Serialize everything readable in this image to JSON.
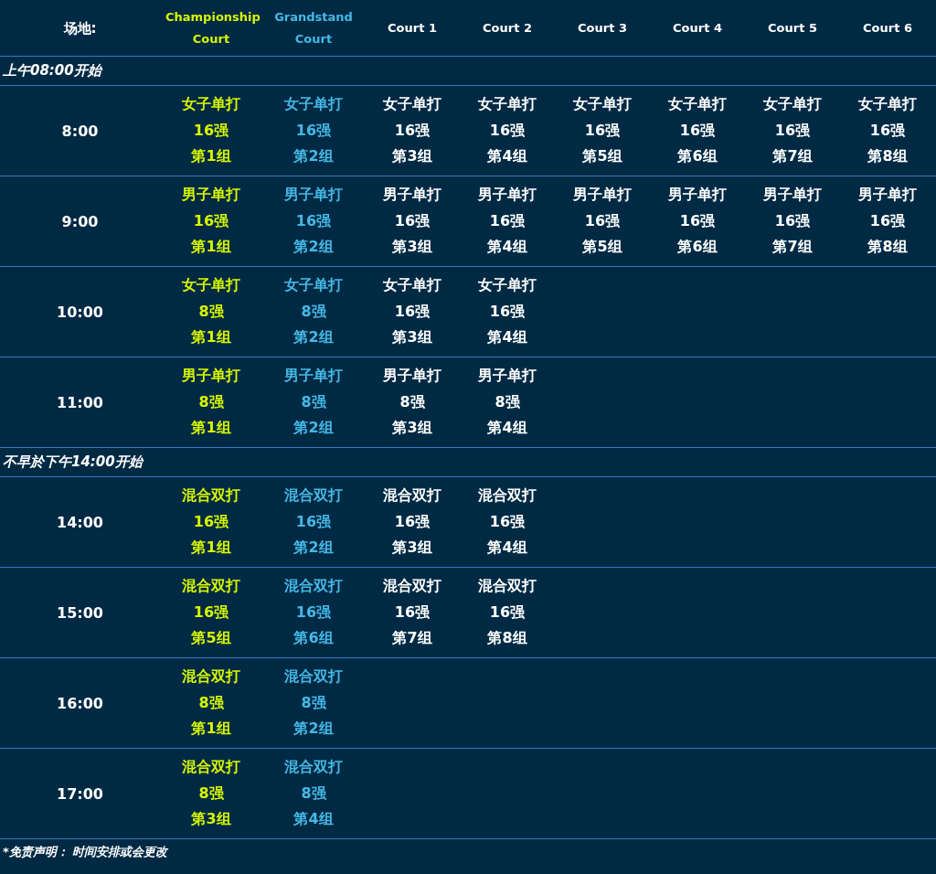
{
  "venue_label": "场地:",
  "courts": [
    {
      "label": "Championship Court",
      "color": "#d7f600"
    },
    {
      "label": "Grandstand Court",
      "color": "#45b8e6"
    },
    {
      "label": "Court 1",
      "color": "#ffffff"
    },
    {
      "label": "Court 2",
      "color": "#ffffff"
    },
    {
      "label": "Court 3",
      "color": "#ffffff"
    },
    {
      "label": "Court 4",
      "color": "#ffffff"
    },
    {
      "label": "Court 5",
      "color": "#ffffff"
    },
    {
      "label": "Court 6",
      "color": "#ffffff"
    }
  ],
  "sections": [
    {
      "heading": "上午08:00开始",
      "rows": [
        {
          "time": "8:00",
          "cells": [
            {
              "event": "女子单打",
              "round": "16强",
              "group": "第1组"
            },
            {
              "event": "女子单打",
              "round": "16强",
              "group": "第2组"
            },
            {
              "event": "女子单打",
              "round": "16强",
              "group": "第3组"
            },
            {
              "event": "女子单打",
              "round": "16强",
              "group": "第4组"
            },
            {
              "event": "女子单打",
              "round": "16强",
              "group": "第5组"
            },
            {
              "event": "女子单打",
              "round": "16强",
              "group": "第6组"
            },
            {
              "event": "女子单打",
              "round": "16强",
              "group": "第7组"
            },
            {
              "event": "女子单打",
              "round": "16强",
              "group": "第8组"
            }
          ]
        },
        {
          "time": "9:00",
          "cells": [
            {
              "event": "男子单打",
              "round": "16强",
              "group": "第1组"
            },
            {
              "event": "男子单打",
              "round": "16强",
              "group": "第2组"
            },
            {
              "event": "男子单打",
              "round": "16强",
              "group": "第3组"
            },
            {
              "event": "男子单打",
              "round": "16强",
              "group": "第4组"
            },
            {
              "event": "男子单打",
              "round": "16强",
              "group": "第5组"
            },
            {
              "event": "男子单打",
              "round": "16强",
              "group": "第6组"
            },
            {
              "event": "男子单打",
              "round": "16强",
              "group": "第7组"
            },
            {
              "event": "男子单打",
              "round": "16强",
              "group": "第8组"
            }
          ]
        },
        {
          "time": "10:00",
          "cells": [
            {
              "event": "女子单打",
              "round": "8强",
              "group": "第1组"
            },
            {
              "event": "女子单打",
              "round": "8强",
              "group": "第2组"
            },
            {
              "event": "女子单打",
              "round": "16强",
              "group": "第3组"
            },
            {
              "event": "女子单打",
              "round": "16强",
              "group": "第4组"
            }
          ]
        },
        {
          "time": "11:00",
          "cells": [
            {
              "event": "男子单打",
              "round": "8强",
              "group": "第1组"
            },
            {
              "event": "男子单打",
              "round": "8强",
              "group": "第2组"
            },
            {
              "event": "男子单打",
              "round": "8强",
              "group": "第3组"
            },
            {
              "event": "男子单打",
              "round": "8强",
              "group": "第4组"
            }
          ]
        }
      ]
    },
    {
      "heading": "不早於下午14:00开始",
      "rows": [
        {
          "time": "14:00",
          "cells": [
            {
              "event": "混合双打",
              "round": "16强",
              "group": "第1组"
            },
            {
              "event": "混合双打",
              "round": "16强",
              "group": "第2组"
            },
            {
              "event": "混合双打",
              "round": "16强",
              "group": "第3组"
            },
            {
              "event": "混合双打",
              "round": "16强",
              "group": "第4组"
            }
          ]
        },
        {
          "time": "15:00",
          "cells": [
            {
              "event": "混合双打",
              "round": "16强",
              "group": "第5组"
            },
            {
              "event": "混合双打",
              "round": "16强",
              "group": "第6组"
            },
            {
              "event": "混合双打",
              "round": "16强",
              "group": "第7组"
            },
            {
              "event": "混合双打",
              "round": "16强",
              "group": "第8组"
            }
          ]
        },
        {
          "time": "16:00",
          "cells": [
            {
              "event": "混合双打",
              "round": "8强",
              "group": "第1组"
            },
            {
              "event": "混合双打",
              "round": "8强",
              "group": "第2组"
            }
          ]
        },
        {
          "time": "17:00",
          "cells": [
            {
              "event": "混合双打",
              "round": "8强",
              "group": "第3组"
            },
            {
              "event": "混合双打",
              "round": "8强",
              "group": "第4组"
            }
          ]
        }
      ]
    }
  ],
  "disclaimer": "*免责声明： 时间安排或会更改"
}
